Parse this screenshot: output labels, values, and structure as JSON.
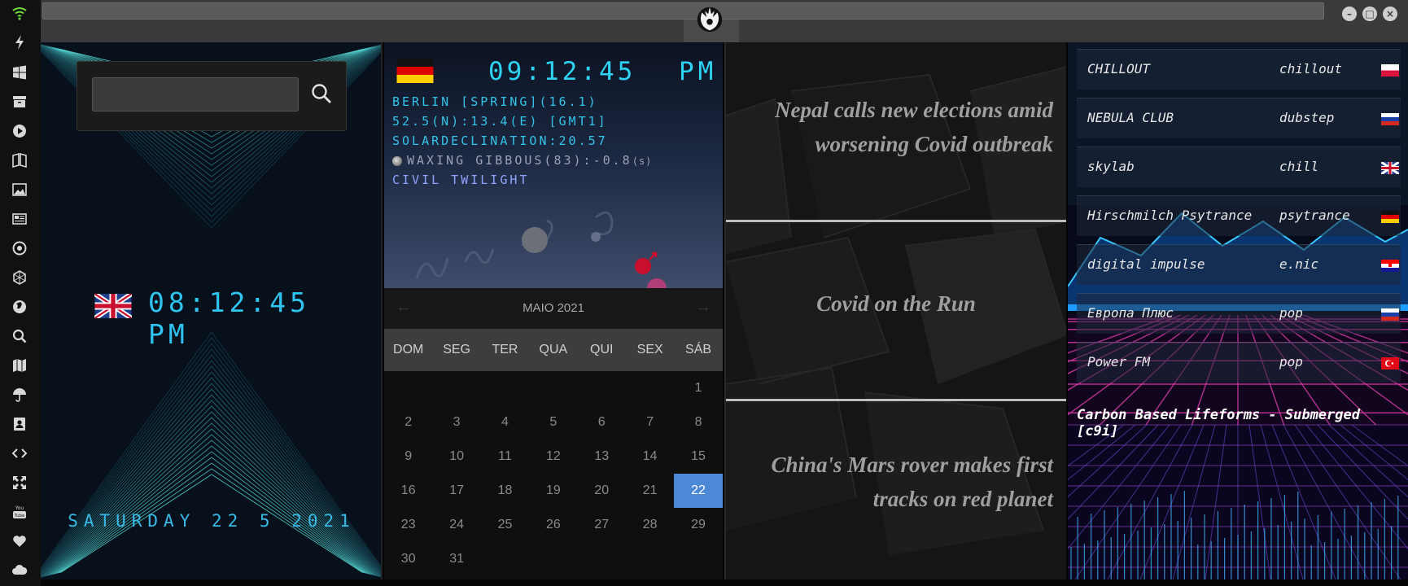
{
  "topbar": {
    "emblem": "rebel-alliance-emblem",
    "minimize_icon": "minimize-icon",
    "maximize_icon": "maximize-icon",
    "close_icon": "close-icon"
  },
  "sidebar": {
    "icons": [
      "wifi-icon",
      "lightning-icon",
      "windows-icon",
      "archive-icon",
      "play-icon",
      "books-icon",
      "image-icon",
      "news-icon",
      "settings-icon",
      "hexagon-icon",
      "globe-icon",
      "search-icon",
      "map-icon",
      "umbrella-icon",
      "contacts-icon",
      "code-icon",
      "fullscreen-icon",
      "youtube-icon",
      "heart-icon",
      "cloud-icon"
    ]
  },
  "world_clock": {
    "search_placeholder": "",
    "flag": "uk-flag",
    "time": "08:12:45 PM",
    "date": "SATURDAY 22 5 2021"
  },
  "astro": {
    "flag": "germany-flag",
    "time": "09:12:45",
    "ampm": "PM",
    "line1": "BERLIN [SPRING](16.1)",
    "line2": "52.5(N):13.4(E) [GMT1]",
    "line3": "SOLARDECLINATION:20.57",
    "line4": "WAXING GIBBOUS(83):-0.8",
    "line4_suffix": "(s)",
    "line5": "CIVIL TWILIGHT"
  },
  "calendar": {
    "month_label": "MAIO 2021",
    "prev": "←",
    "next": "→",
    "weekdays": [
      "DOM",
      "SEG",
      "TER",
      "QUA",
      "QUI",
      "SEX",
      "SÁB"
    ],
    "days": [
      "",
      "",
      "",
      "",
      "",
      "",
      "1",
      "2",
      "3",
      "4",
      "5",
      "6",
      "7",
      "8",
      "9",
      "10",
      "11",
      "12",
      "13",
      "14",
      "15",
      "16",
      "17",
      "18",
      "19",
      "20",
      "21",
      "22",
      "23",
      "24",
      "25",
      "26",
      "27",
      "28",
      "29",
      "30",
      "31"
    ],
    "selected_day": "22"
  },
  "news": {
    "items": [
      "Nepal calls new elections amid worsening Covid outbreak",
      "Covid on the Run",
      "China's Mars rover makes first tracks on red planet"
    ]
  },
  "radio": {
    "stations": [
      {
        "name": "CHILLOUT",
        "genre": "chillout",
        "flag": "poland-flag"
      },
      {
        "name": "NEBULA CLUB",
        "genre": "dubstep",
        "flag": "russia-flag"
      },
      {
        "name": "skylab",
        "genre": "chill",
        "flag": "uk-flag"
      },
      {
        "name": "Hirschmilch Psytrance",
        "genre": "psytrance",
        "flag": "germany-flag"
      },
      {
        "name": "digital impulse",
        "genre": "e.nic",
        "flag": "croatia-flag"
      },
      {
        "name": "Европа Плюс",
        "genre": "pop",
        "flag": "russia-flag"
      },
      {
        "name": "Power FM",
        "genre": "pop",
        "flag": "turkey-flag"
      }
    ],
    "now_playing": "Carbon Based Lifeforms - Submerged [c9i]"
  }
}
